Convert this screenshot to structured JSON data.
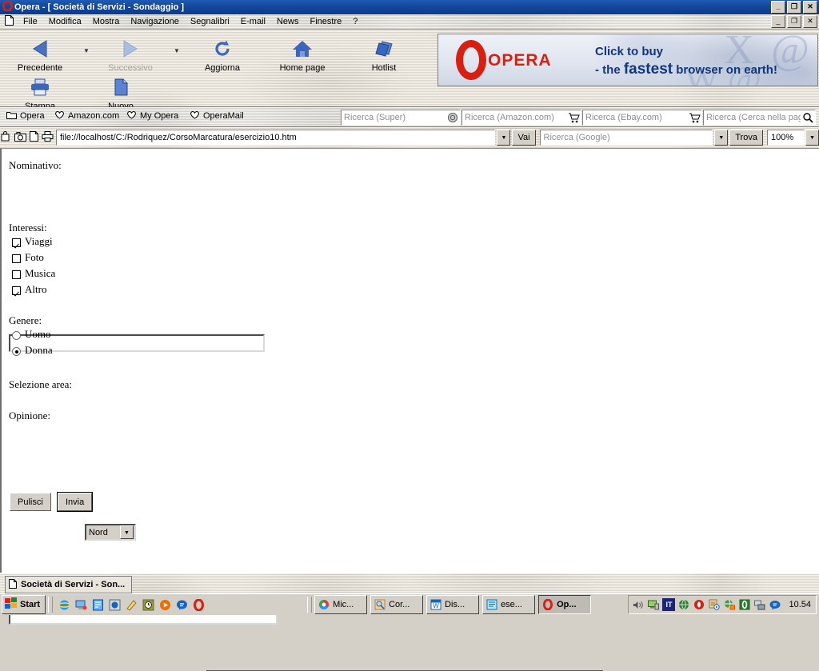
{
  "window": {
    "title": "Opera - [ Società di Servizi - Sondaggio ]",
    "minimize_label": "_",
    "maximize_label": "❐",
    "close_label": "✕"
  },
  "menubar": {
    "items": [
      {
        "label": "File"
      },
      {
        "label": "Modifica"
      },
      {
        "label": "Mostra"
      },
      {
        "label": "Navigazione"
      },
      {
        "label": "Segnalibri"
      },
      {
        "label": "E-mail"
      },
      {
        "label": "News"
      },
      {
        "label": "Finestre"
      },
      {
        "label": "?"
      }
    ],
    "minimize_label": "_",
    "restore_label": "❐",
    "close_label": "✕"
  },
  "toolbar": {
    "buttons": [
      {
        "label": "Precedente",
        "icon": "back-arrow-icon",
        "disabled": false
      },
      {
        "label": "Successivo",
        "icon": "forward-arrow-icon",
        "disabled": true
      },
      {
        "label": "Aggiorna",
        "icon": "reload-icon",
        "disabled": false
      },
      {
        "label": "Home page",
        "icon": "home-icon",
        "disabled": false
      },
      {
        "label": "Hotlist",
        "icon": "hotlist-icon",
        "disabled": false
      },
      {
        "label": "Stampa",
        "icon": "printer-icon",
        "disabled": false
      },
      {
        "label": "Nuovo",
        "icon": "new-page-icon",
        "disabled": false
      }
    ],
    "quick_field_value": ""
  },
  "banner": {
    "brand": "OPERA",
    "line1": "Click to buy",
    "line2_pre": "- the ",
    "line2_em": "fastest",
    "line2_post": " browser on earth!",
    "brand_color": "#d81f12",
    "text_color": "#12357f"
  },
  "bookmarks": {
    "items": [
      {
        "label": "Opera",
        "icon": "folder-icon"
      },
      {
        "label": "Amazon.com",
        "icon": "heart-icon"
      },
      {
        "label": "My Opera",
        "icon": "heart-icon"
      },
      {
        "label": "OperaMail",
        "icon": "heart-icon"
      }
    ]
  },
  "searchbars": [
    {
      "placeholder": "Ricerca (Super)",
      "value": "",
      "icon": "super-search-icon"
    },
    {
      "placeholder": "Ricerca (Amazon.com)",
      "value": "",
      "icon": "cart-icon"
    },
    {
      "placeholder": "Ricerca (Ebay.com)",
      "value": "",
      "icon": "cart-icon"
    },
    {
      "placeholder": "Ricerca (Cerca nella pagina)",
      "value": "",
      "icon": "magnifier-icon"
    }
  ],
  "addressbar": {
    "icons": [
      "bookmark-add-icon",
      "snapshot-icon",
      "new-doc-icon",
      "print-icon"
    ],
    "url": "file://localhost/C:/Rodriquez/CorsoMarcatura/esercizio10.htm",
    "go_label": "Vai",
    "google_placeholder": "Ricerca (Google)",
    "google_value": "",
    "find_label": "Trova",
    "zoom_value": "100%"
  },
  "page": {
    "nominativo_label": "Nominativo:",
    "nominativo_value": "",
    "interessi_label": "Interessi:",
    "interessi": [
      {
        "label": "Viaggi",
        "checked": true
      },
      {
        "label": "Foto",
        "checked": false
      },
      {
        "label": "Musica",
        "checked": false
      },
      {
        "label": "Altro",
        "checked": true
      }
    ],
    "genere_label": "Genere:",
    "genere": [
      {
        "label": "Uomo",
        "selected": false
      },
      {
        "label": "Donna",
        "selected": true
      }
    ],
    "area_label": "Selezione area:",
    "area_value": "Nord",
    "area_options": [
      "Nord"
    ],
    "opinione_label": "Opinione:",
    "opinione_value": "",
    "reset_label": "Pulisci",
    "submit_label": "Invia"
  },
  "status": {
    "text": ""
  },
  "windowtab": {
    "label": "Società di Servizi - Son...",
    "icon": "page-icon"
  },
  "taskbar": {
    "start_label": "Start",
    "quicklaunch": [
      {
        "icon": "ie-icon"
      },
      {
        "icon": "desktop-icon"
      },
      {
        "icon": "frontpage-icon"
      },
      {
        "icon": "media-icon"
      },
      {
        "icon": "pencil-icon"
      },
      {
        "icon": "clock-icon"
      },
      {
        "icon": "player-icon"
      },
      {
        "icon": "msn-icon"
      },
      {
        "icon": "opera-icon"
      }
    ],
    "items": [
      {
        "label": "Mic...",
        "icon": "chrome-ball-icon",
        "active": false
      },
      {
        "label": "Cor...",
        "icon": "search-doc-icon",
        "active": false
      },
      {
        "label": "Dis...",
        "icon": "word-icon",
        "active": false
      },
      {
        "label": "ese...",
        "icon": "notepad-icon",
        "active": false
      },
      {
        "label": "Op...",
        "icon": "opera-icon",
        "active": true
      }
    ],
    "tray": [
      {
        "icon": "volume-icon"
      },
      {
        "icon": "display-icon"
      },
      {
        "icon": "lang-it-icon",
        "label": "IT"
      },
      {
        "icon": "globe-icon"
      },
      {
        "icon": "opera-tray-icon"
      },
      {
        "icon": "scheduler-icon"
      },
      {
        "icon": "network-globe-icon"
      },
      {
        "icon": "shield-icon"
      },
      {
        "icon": "network-icon"
      },
      {
        "icon": "msn-tray-icon"
      }
    ],
    "clock": "10.54"
  }
}
